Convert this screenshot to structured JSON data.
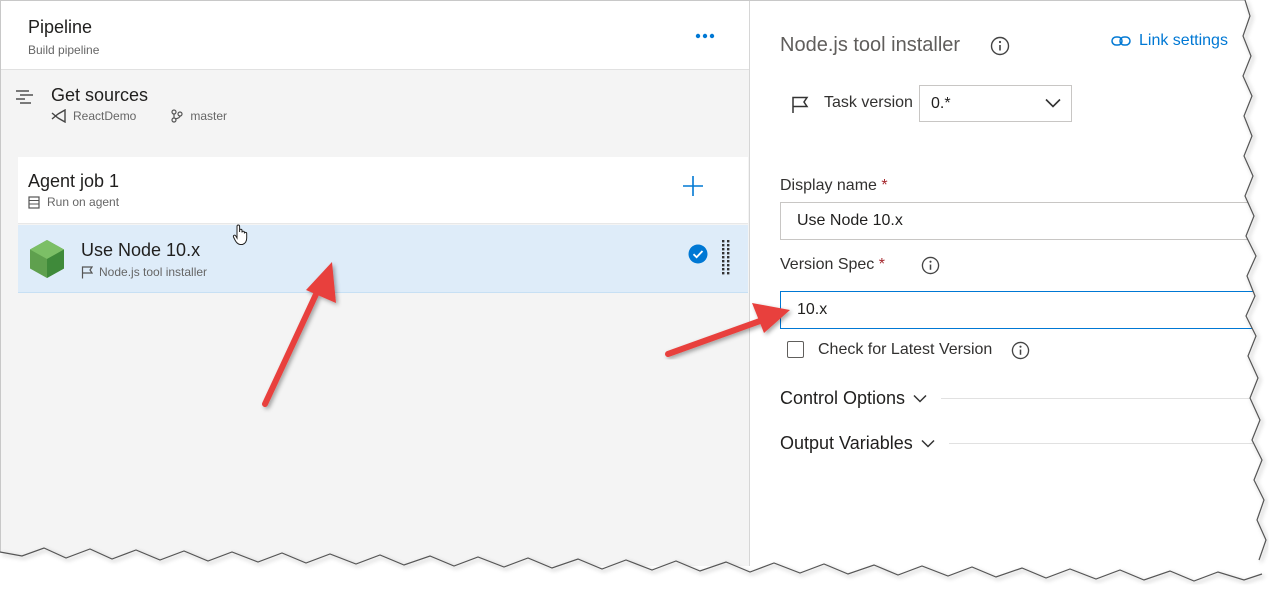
{
  "pipeline": {
    "title": "Pipeline",
    "subtitle": "Build pipeline",
    "more_icon": "ellipsis-icon"
  },
  "sources": {
    "title": "Get sources",
    "repo": "ReactDemo",
    "branch": "master"
  },
  "agent_job": {
    "title": "Agent job 1",
    "subtitle": "Run on agent"
  },
  "task": {
    "title": "Use Node 10.x",
    "subtitle": "Node.js tool installer"
  },
  "panel": {
    "title": "Node.js tool installer",
    "link_settings": "Link settings",
    "task_version_label": "Task version",
    "task_version_value": "0.*",
    "display_name_label": "Display name",
    "display_name_value": "Use Node 10.x",
    "version_spec_label": "Version Spec",
    "version_spec_value": "10.x",
    "required_marker": "*",
    "check_latest_label": "Check for Latest Version",
    "control_options": "Control Options",
    "output_variables": "Output Variables"
  },
  "colors": {
    "accent": "#0078d4",
    "selected_row": "#deecf9",
    "arrow": "#e8413d",
    "node_green": "#5fa04e"
  }
}
